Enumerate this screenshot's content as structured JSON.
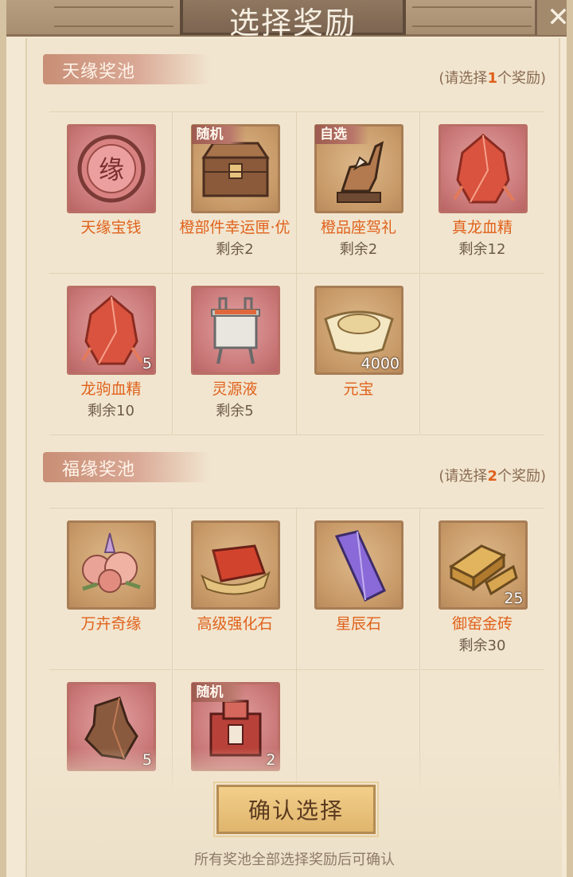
{
  "header": {
    "title": "选择奖励",
    "close_icon": "close-x-icon"
  },
  "pools": [
    {
      "title": "天缘奖池",
      "hint_prefix": "(请选择",
      "hint_count": "1",
      "hint_suffix": "个奖励)",
      "items": [
        {
          "name": "天缘宝钱",
          "remain": "",
          "tag": "",
          "qty": "",
          "frame": "red",
          "icon": "coin-icon"
        },
        {
          "name": "橙部件幸运匣·优",
          "remain": "剩余2",
          "tag": "随机",
          "qty": "",
          "frame": "gold",
          "icon": "chest-icon"
        },
        {
          "name": "橙品座驾礼",
          "remain": "剩余2",
          "tag": "自选",
          "qty": "",
          "frame": "gold",
          "icon": "horse-icon"
        },
        {
          "name": "真龙血精",
          "remain": "剩余12",
          "tag": "",
          "qty": "",
          "frame": "red",
          "icon": "red-crystal-icon"
        },
        {
          "name": "龙驹血精",
          "remain": "剩余10",
          "tag": "",
          "qty": "5",
          "frame": "red",
          "icon": "red-crystal-icon"
        },
        {
          "name": "灵源液",
          "remain": "剩余5",
          "tag": "",
          "qty": "",
          "frame": "red",
          "icon": "cauldron-icon"
        },
        {
          "name": "元宝",
          "remain": "",
          "tag": "",
          "qty": "4000",
          "frame": "gold",
          "icon": "gold-ingot-icon"
        }
      ]
    },
    {
      "title": "福缘奖池",
      "hint_prefix": "(请选择",
      "hint_count": "2",
      "hint_suffix": "个奖励)",
      "items": [
        {
          "name": "万卉奇缘",
          "remain": "",
          "tag": "",
          "qty": "",
          "frame": "gold",
          "icon": "flower-bouquet-icon"
        },
        {
          "name": "高级强化石",
          "remain": "",
          "tag": "",
          "qty": "",
          "frame": "gold",
          "icon": "red-stone-icon"
        },
        {
          "name": "星辰石",
          "remain": "",
          "tag": "",
          "qty": "",
          "frame": "gold",
          "icon": "purple-crystal-icon"
        },
        {
          "name": "御窑金砖",
          "remain": "剩余30",
          "tag": "",
          "qty": "25",
          "frame": "gold",
          "icon": "gold-brick-icon"
        },
        {
          "name": "",
          "remain": "",
          "tag": "",
          "qty": "5",
          "frame": "red",
          "icon": "ore-rock-icon"
        },
        {
          "name": "",
          "remain": "",
          "tag": "随机",
          "qty": "2",
          "frame": "red",
          "icon": "treasure-bundle-icon"
        }
      ]
    }
  ],
  "footer": {
    "confirm_label": "确认选择",
    "confirm_hint": "所有奖池全部选择奖励后可确认"
  }
}
